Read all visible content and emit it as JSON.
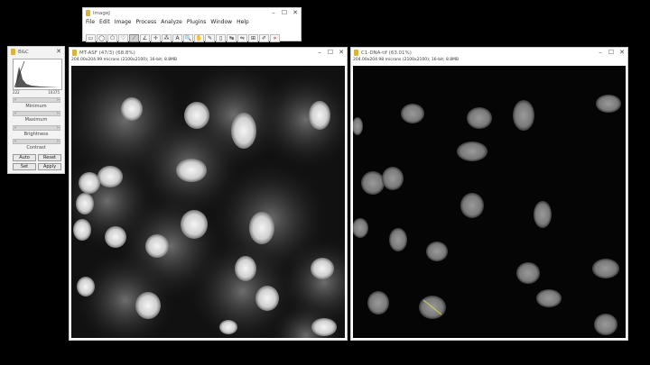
{
  "imagej": {
    "title": "ImageJ",
    "menu": [
      "File",
      "Edit",
      "Image",
      "Process",
      "Analyze",
      "Plugins",
      "Window",
      "Help"
    ],
    "tools": [
      "rect-tool-icon",
      "oval-tool-icon",
      "polygon-tool-icon",
      "freehand-tool-icon",
      "line-tool-icon",
      "angle-tool-icon",
      "point-tool-icon",
      "wand-tool-icon",
      "text-tool-icon",
      "zoom-tool-icon",
      "hand-tool-icon",
      "dropper-tool-icon",
      "custom-tool-icon",
      "stk-tool-icon",
      "lut-tool-icon",
      "dev-tool-icon",
      "pencil-tool-icon",
      "more-tools-icon"
    ],
    "tool_glyphs": [
      "▭",
      "◯",
      "⬠",
      "♡",
      "⟋",
      "∠",
      "✛",
      "⁂",
      "A",
      "🔍",
      "✋",
      "✎",
      "▯",
      "↹",
      "⇋",
      "⊞",
      "✐",
      "»"
    ],
    "selected_tool": 4
  },
  "bc": {
    "title": "B&C",
    "hist_min": "222",
    "hist_max": "10375",
    "labels": [
      "Minimum",
      "Maximum",
      "Brightness",
      "Contrast"
    ],
    "buttons": {
      "auto": "Auto",
      "reset": "Reset",
      "set": "Set",
      "apply": "Apply"
    }
  },
  "win1": {
    "title": "MT-ASF (47/3) (68.8%)",
    "info": "204.00x204.99 microns (2100x2100); 16-bit; 8.8MB",
    "controls": [
      "–",
      "☐",
      "✕"
    ]
  },
  "win2": {
    "title": "C1-DNA-tif (63.01%)",
    "info": "204.00x204.98 microns (2100x2100); 16-bit; 8.8MB",
    "controls": [
      "–",
      "☐",
      "✕"
    ]
  }
}
